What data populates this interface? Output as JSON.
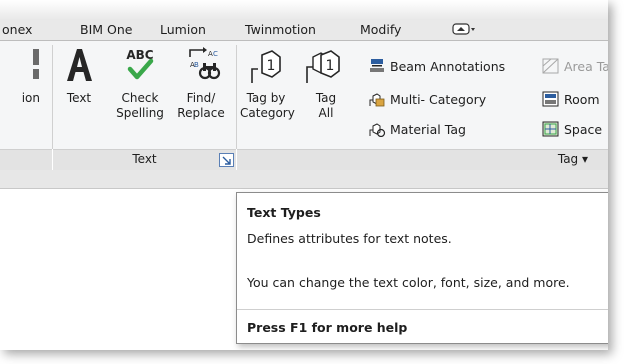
{
  "tabs": {
    "t0": "onex",
    "t1": "BIM One",
    "t2": "Lumion",
    "t3": "Twinmotion",
    "t4": "Modify",
    "t5": "▾"
  },
  "ribbon": {
    "partial_label": "ion",
    "text_button": "Text",
    "check_spelling": [
      "Check",
      "Spelling"
    ],
    "find_replace": [
      "Find/",
      "Replace"
    ],
    "text_panel_title": "Text",
    "tag_by_category": [
      "Tag by",
      "Category"
    ],
    "tag_all": [
      "Tag",
      "All"
    ],
    "beam_annotations": "Beam  Annotations",
    "multi_category": "Multi- Category",
    "material_tag": "Material  Tag",
    "area_tag": "Area  Ta",
    "room_tag": "Room",
    "space_tag": "Space",
    "tag_panel_title": "Tag ▾"
  },
  "tooltip": {
    "title": "Text Types",
    "line1": "Defines attributes for text notes.",
    "line2": "You can change the text color, font, size, and more.",
    "help": "Press F1 for more help"
  },
  "colors": {
    "accent_green": "#3aa84a",
    "icon_blue": "#2c5d9f",
    "tooltip_border": "#8c8c8c"
  }
}
